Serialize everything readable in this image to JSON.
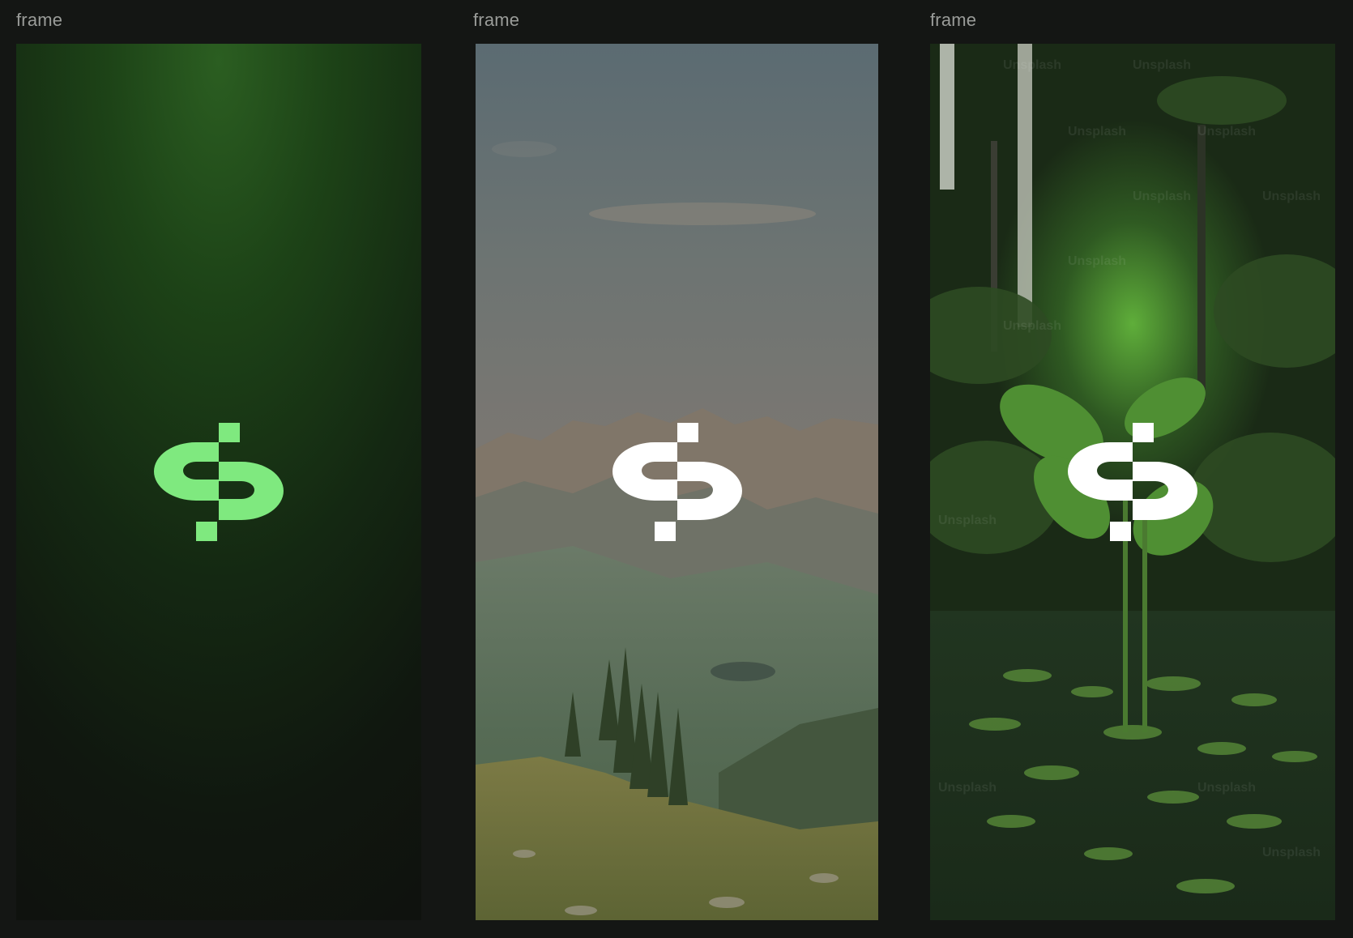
{
  "frames": [
    {
      "label": "frame",
      "background": "green-radial-gradient",
      "logo_color": "#7fe97f"
    },
    {
      "label": "frame",
      "background": "mountain-photo",
      "logo_color": "#ffffff"
    },
    {
      "label": "frame",
      "background": "jungle-photo",
      "logo_color": "#ffffff",
      "watermark_text": "Unsplash"
    }
  ],
  "colors": {
    "canvas_bg": "#141614",
    "brand_green": "#7fe97f",
    "dark_green": "#1f4a1c"
  }
}
